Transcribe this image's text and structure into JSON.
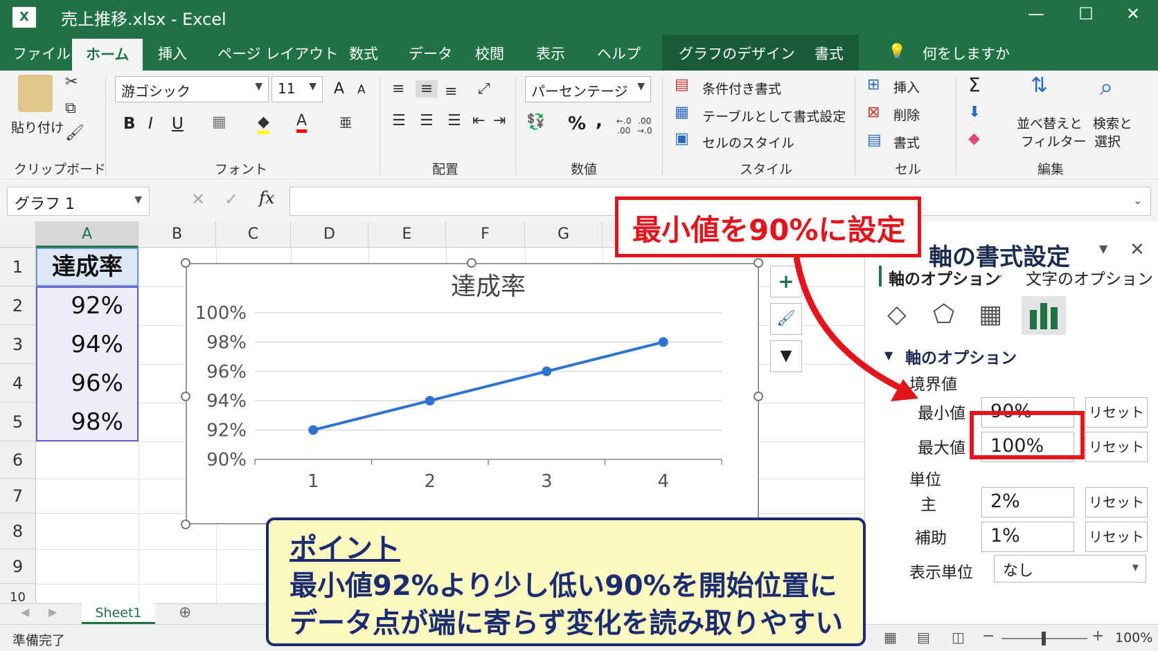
{
  "window": {
    "file_title": "売上推移.xlsx  -  Excel",
    "app_icon": "X",
    "minimize": "—",
    "maximize": "☐",
    "close": "✕"
  },
  "tabs": [
    "ファイル",
    "ホーム",
    "挿入",
    "ページ レイアウト",
    "数式",
    "データ",
    "校閲",
    "表示",
    "ヘルプ",
    "グラフのデザイン",
    "書式"
  ],
  "tell_me": "何をしますか",
  "ribbon": {
    "clipboard": {
      "paste": "貼り付け",
      "label": "クリップボード"
    },
    "font": {
      "family": "游ゴシック",
      "size": "11",
      "grow": "A",
      "shrink": "A",
      "bold": "B",
      "italic": "I",
      "underline": "U",
      "label": "フォント"
    },
    "alignment": {
      "label": "配置"
    },
    "number": {
      "format": "パーセンテージ",
      "percent": "%",
      "comma": ",",
      "label": "数値"
    },
    "styles": {
      "conditional": "条件付き書式",
      "table": "テーブルとして書式設定",
      "cell_style": "セルのスタイル",
      "label": "スタイル"
    },
    "cells": {
      "insert": "挿入",
      "delete": "削除",
      "format": "書式",
      "label": "セル"
    },
    "editing": {
      "sum": "Σ",
      "sort": "並べ替えと\nフィルター",
      "sort_l1": "並べ替えと",
      "sort_l2": "フィルター",
      "find_l1": "検索と",
      "find_l2": "選択",
      "label": "編集"
    }
  },
  "formula_bar": {
    "name_box": "グラフ 1",
    "cancel": "✕",
    "enter": "✓",
    "fx": "fx",
    "value": ""
  },
  "sheet": {
    "columns": [
      "A",
      "B",
      "C",
      "D",
      "E",
      "F",
      "G"
    ],
    "rows": [
      "1",
      "2",
      "3",
      "4",
      "5",
      "6",
      "7",
      "8",
      "9",
      "10"
    ],
    "header_cell": "達成率",
    "values": [
      "92%",
      "94%",
      "96%",
      "98%"
    ]
  },
  "chart_data": {
    "type": "line",
    "title": "達成率",
    "categories": [
      "1",
      "2",
      "3",
      "4"
    ],
    "values": [
      0.92,
      0.94,
      0.96,
      0.98
    ],
    "y_ticks": [
      "100%",
      "98%",
      "96%",
      "94%",
      "92%",
      "90%"
    ],
    "ylim": [
      0.9,
      1.0
    ],
    "grid": true,
    "color": "#2e75d0"
  },
  "chart_buttons": {
    "add": "+",
    "style": "brush",
    "filter": "filter"
  },
  "callout": "最小値を90%に設定",
  "point": {
    "title": "ポイント",
    "line1": "最小値92%より少し低い90%を開始位置に",
    "line2": "データ点が端に寄らず変化を読み取りやすい"
  },
  "pane": {
    "title": "軸の書式設定",
    "tab_axis": "軸のオプション",
    "tab_text": "文字のオプション",
    "section": "軸のオプション",
    "bounds_label": "境界値",
    "min_label": "最小値",
    "min_value": "90%",
    "max_label": "最大値",
    "max_value": "100%",
    "units_label": "単位",
    "major_label": "主",
    "major_value": "2%",
    "minor_label": "補助",
    "minor_value": "1%",
    "display_units_label": "表示単位",
    "display_units_value": "なし",
    "reset": "リセット"
  },
  "sheet_tab": "Sheet1",
  "status": {
    "ready": "準備完了",
    "zoom": "100%"
  }
}
